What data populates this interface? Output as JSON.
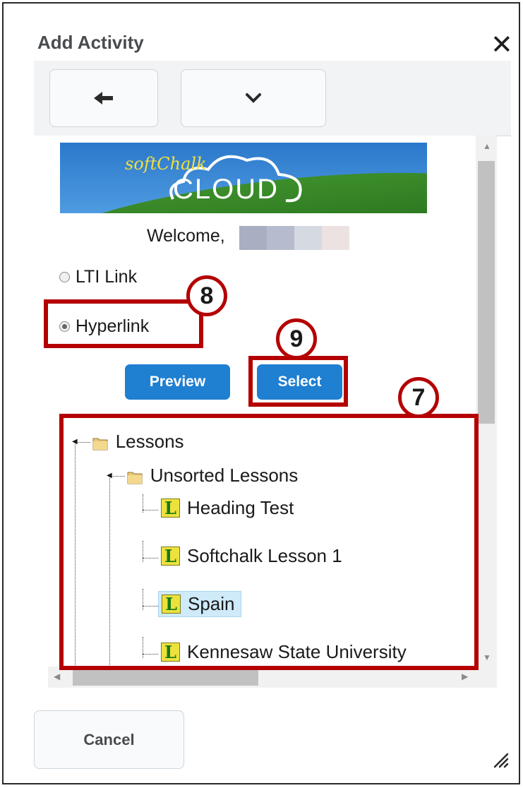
{
  "dialog": {
    "title": "Add Activity",
    "close_icon": "close-icon"
  },
  "toolbar": {
    "back_icon": "arrow-left-icon",
    "more_icon": "chevron-down-icon"
  },
  "banner": {
    "logo_top": "softChalk",
    "logo_bottom": "CLOUD"
  },
  "welcome": {
    "text": "Welcome,"
  },
  "options": [
    {
      "label": "LTI Link",
      "checked": false
    },
    {
      "label": "Hyperlink",
      "checked": true
    }
  ],
  "buttons": {
    "preview": "Preview",
    "select": "Select"
  },
  "tree": {
    "root": "Lessons",
    "folder": "Unsorted Lessons",
    "lessons": [
      "Heading Test",
      "Softchalk Lesson 1",
      "Spain",
      "Kennesaw State University"
    ],
    "selected": "Spain",
    "lesson_icon_letter": "L"
  },
  "annotations": {
    "step7": "7",
    "step8": "8",
    "step9": "9",
    "highlight_color": "#b40000"
  },
  "footer": {
    "cancel": "Cancel"
  },
  "colors": {
    "primary_button": "#1f7fd1",
    "selected_bg": "#cfeaf9"
  }
}
